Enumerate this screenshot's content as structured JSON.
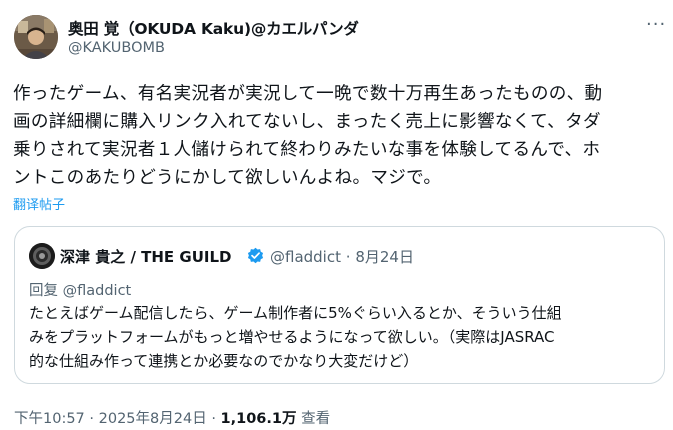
{
  "author": {
    "display_name": "奥田 覚（OKUDA Kaku)@カエルパンダ",
    "handle": "@KAKUBOMB"
  },
  "more_icon": "more-horizontal-icon",
  "tweet": {
    "lines": [
      "作ったゲーム、有名実況者が実況して一晩で数十万再生あったものの、動",
      "画の詳細欄に購入リンク入れてないし、まったく売上に影響なくて、タダ",
      "乗りされて実況者１人儲けられて終わりみたいな事を体験してるんで、ホ",
      "ントこのあたりどうにかして欲しいんよね。マジで。"
    ],
    "translate_label": "翻译帖子"
  },
  "quote": {
    "display_name": "深津 貴之 / THE GUILD",
    "handle": "@fladdict",
    "date": "8月24日",
    "separator": "·",
    "reply_prefix": "回复",
    "reply_handle": "@fladdict",
    "lines": [
      "たとえばゲーム配信したら、ゲーム制作者に5%ぐらい入るとか、そういう仕組",
      "みをプラットフォームがもっと増やせるようになって欲しい。（実際はJASRAC",
      "的な仕組み作って連携とか必要なのでかなり大変だけど）"
    ],
    "verified_color": "#1d9bf0"
  },
  "footer": {
    "time": "下午10:57",
    "date": "2025年8月24日",
    "separator": "·",
    "views_count": "1,106.1万",
    "views_label": "查看"
  }
}
